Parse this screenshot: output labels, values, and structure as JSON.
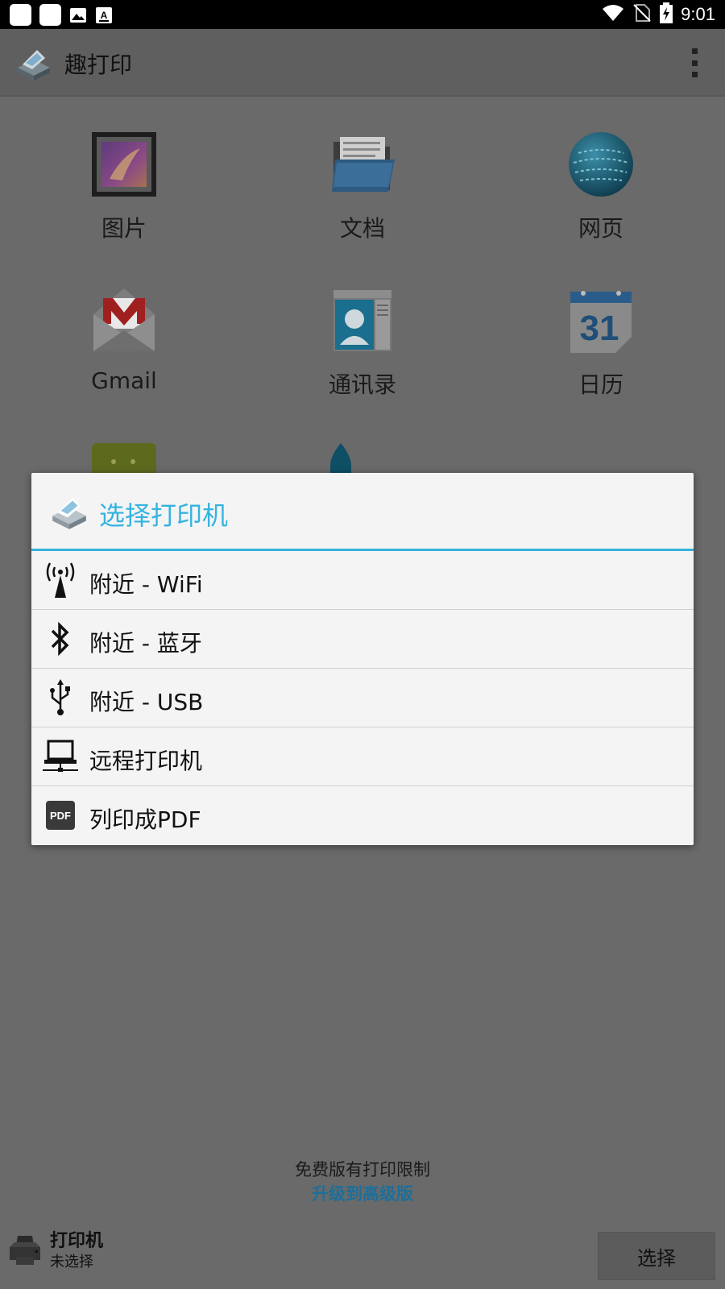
{
  "status_bar": {
    "time": "9:01"
  },
  "app_bar": {
    "title": "趣打印"
  },
  "grid": [
    {
      "label": "图片",
      "icon": "pictures-icon"
    },
    {
      "label": "文档",
      "icon": "documents-folder-icon"
    },
    {
      "label": "网页",
      "icon": "web-globe-icon"
    },
    {
      "label": "Gmail",
      "icon": "gmail-icon"
    },
    {
      "label": "通讯录",
      "icon": "contacts-icon"
    },
    {
      "label": "日历",
      "icon": "calendar-icon"
    }
  ],
  "calendar_day": "31",
  "dialog": {
    "title": "选择打印机",
    "options": [
      {
        "label": "附近 - WiFi",
        "icon": "wifi-antenna-icon"
      },
      {
        "label": "附近 - 蓝牙",
        "icon": "bluetooth-icon"
      },
      {
        "label": "附近 - USB",
        "icon": "usb-icon"
      },
      {
        "label": "远程打印机",
        "icon": "remote-computer-icon"
      },
      {
        "label": "列印成PDF",
        "icon": "pdf-icon"
      }
    ]
  },
  "pdf_badge": "PDF",
  "footer": {
    "limit_text": "免费版有打印限制",
    "upgrade_link": "升级到高级版"
  },
  "printer": {
    "title": "打印机",
    "status": "未选择",
    "select_button": "选择"
  },
  "colors": {
    "accent": "#34b3df",
    "dim_background": "#6a6a6a",
    "dialog_background": "#f4f4f4",
    "link": "#1c6f9a"
  }
}
